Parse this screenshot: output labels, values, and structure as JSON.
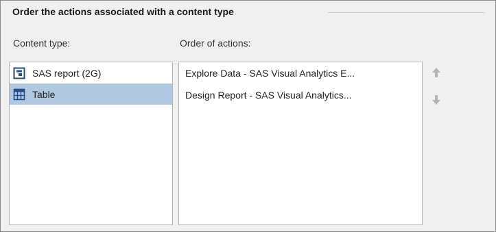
{
  "section": {
    "title": "Order the actions associated with a content type"
  },
  "content_type": {
    "label": "Content type:",
    "items": [
      {
        "label": "SAS report (2G)",
        "icon": "report-icon",
        "selected": false
      },
      {
        "label": "Table",
        "icon": "table-icon",
        "selected": true
      }
    ]
  },
  "order_of_actions": {
    "label": "Order of actions:",
    "items": [
      {
        "label": "Explore Data - SAS Visual Analytics E..."
      },
      {
        "label": "Design Report - SAS Visual Analytics..."
      }
    ]
  },
  "controls": {
    "move_up_icon": "arrow-up-icon",
    "move_down_icon": "arrow-down-icon"
  },
  "colors": {
    "selection": "#b0c8e0",
    "icon_accent": "#1f4e8c",
    "arrow_disabled": "#b4b4b4"
  }
}
